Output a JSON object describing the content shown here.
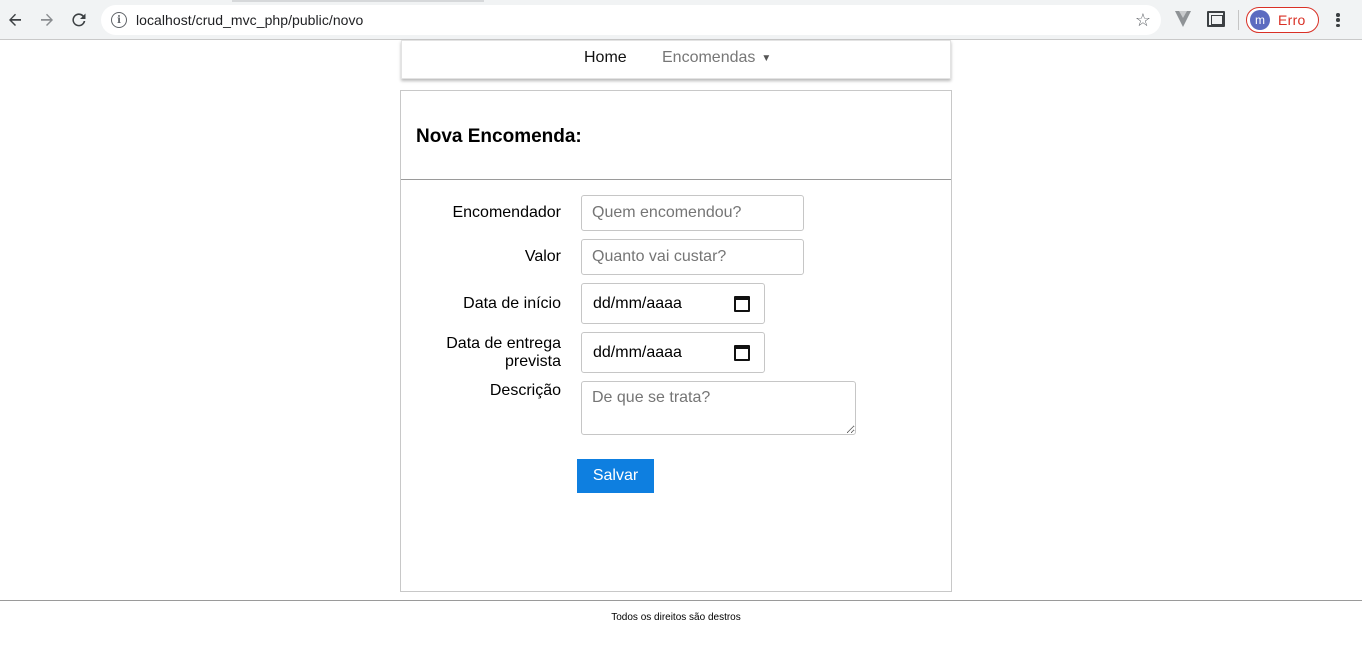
{
  "browser": {
    "url": "localhost/crud_mvc_php/public/novo",
    "profile_initial": "m",
    "profile_label": "Erro",
    "back_icon": "arrow-left-icon",
    "forward_icon": "arrow-right-icon",
    "reload_icon": "reload-icon",
    "info_glyph": "i",
    "star_glyph": "☆"
  },
  "nav": {
    "home_label": "Home",
    "encomendas_label": "Encomendas",
    "caret_glyph": "▼"
  },
  "form": {
    "title": "Nova Encomenda:",
    "fields": {
      "encomendador": {
        "label": "Encomendador",
        "placeholder": "Quem encomendou?"
      },
      "valor": {
        "label": "Valor",
        "placeholder": "Quanto vai custar?"
      },
      "data_inicio": {
        "label": "Data de início",
        "value": "dd/mm/aaaa"
      },
      "data_entrega_1": {
        "label": "Data de entrega"
      },
      "data_entrega_2": {
        "label": "prevista"
      },
      "data_entrega": {
        "value": "dd/mm/aaaa"
      },
      "descricao": {
        "label": "Descrição",
        "placeholder": "De que se trata?"
      }
    },
    "submit_label": "Salvar"
  },
  "footer": {
    "text": "Todos os direitos são destros"
  },
  "colors": {
    "primary_button": "#0e7fe0",
    "error_red": "#d93025",
    "avatar_blue": "#5c6bc0"
  }
}
